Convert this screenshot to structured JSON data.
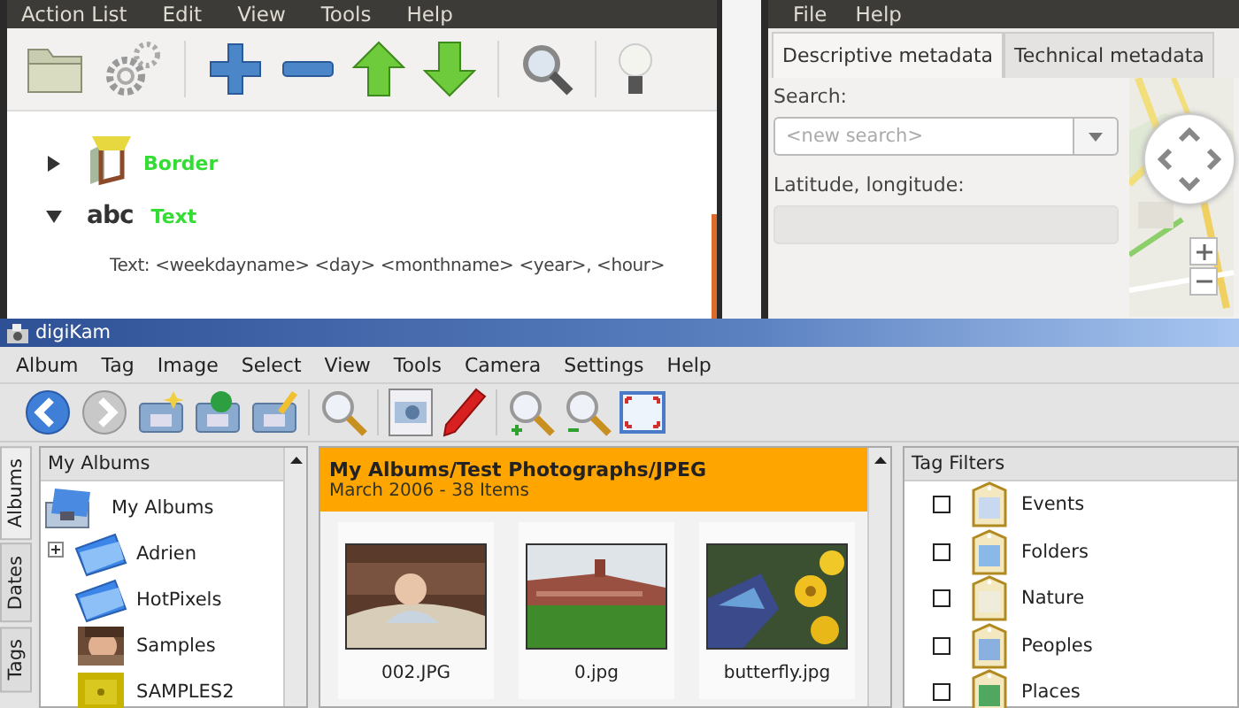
{
  "action_list_window": {
    "menu": [
      "Action List",
      "Edit",
      "View",
      "Tools",
      "Help"
    ],
    "tree": [
      {
        "kind": "border",
        "label": "Border",
        "expanded": false
      },
      {
        "kind": "text",
        "icon_text": "abc",
        "label": "Text",
        "expanded": true,
        "children": [
          {
            "label": "Text: <weekdayname> <day> <monthname> <year>, <hour>"
          }
        ]
      }
    ]
  },
  "metadata_window": {
    "menu": [
      "File",
      "Help"
    ],
    "tabs": [
      {
        "label": "Descriptive metadata",
        "selected": true
      },
      {
        "label": "Technical metadata",
        "selected": false
      }
    ],
    "search_label": "Search:",
    "search": {
      "placeholder": "<new search>"
    },
    "coords_label": "Latitude, longitude:",
    "coords": {
      "disabled": true
    },
    "map": {
      "kind": "picture"
    }
  },
  "digikam": {
    "title": "digiKam",
    "menu": [
      "Album",
      "Tag",
      "Image",
      "Select",
      "View",
      "Tools",
      "Camera",
      "Settings",
      "Help"
    ],
    "side_tabs": [
      {
        "label": "Albums",
        "selected": true
      },
      {
        "label": "Dates",
        "selected": false
      },
      {
        "label": "Tags",
        "selected": false
      }
    ],
    "albums": {
      "header": "My Albums",
      "root": {
        "label": "My Albums",
        "children": [
          {
            "label": "Adrien",
            "kind": "folder",
            "expanded": false
          },
          {
            "label": "HotPixels",
            "kind": "folder"
          },
          {
            "label": "Samples",
            "kind": "picture"
          },
          {
            "label": "SAMPLES2",
            "kind": "picture"
          }
        ]
      }
    },
    "album_header": {
      "path": "My Albums/Test Photographs/JPEG",
      "summary": "March 2006 - 38 Items"
    },
    "thumbnails": [
      {
        "caption": "002.JPG"
      },
      {
        "caption": "0.jpg"
      },
      {
        "caption": "butterfly.jpg"
      }
    ],
    "tag_filters": {
      "header": "Tag Filters",
      "items": [
        {
          "label": "Events",
          "checked": false
        },
        {
          "label": "Folders",
          "checked": false
        },
        {
          "label": "Nature",
          "checked": false
        },
        {
          "label": "Peoples",
          "checked": false
        },
        {
          "label": "Places",
          "checked": false
        }
      ]
    }
  }
}
